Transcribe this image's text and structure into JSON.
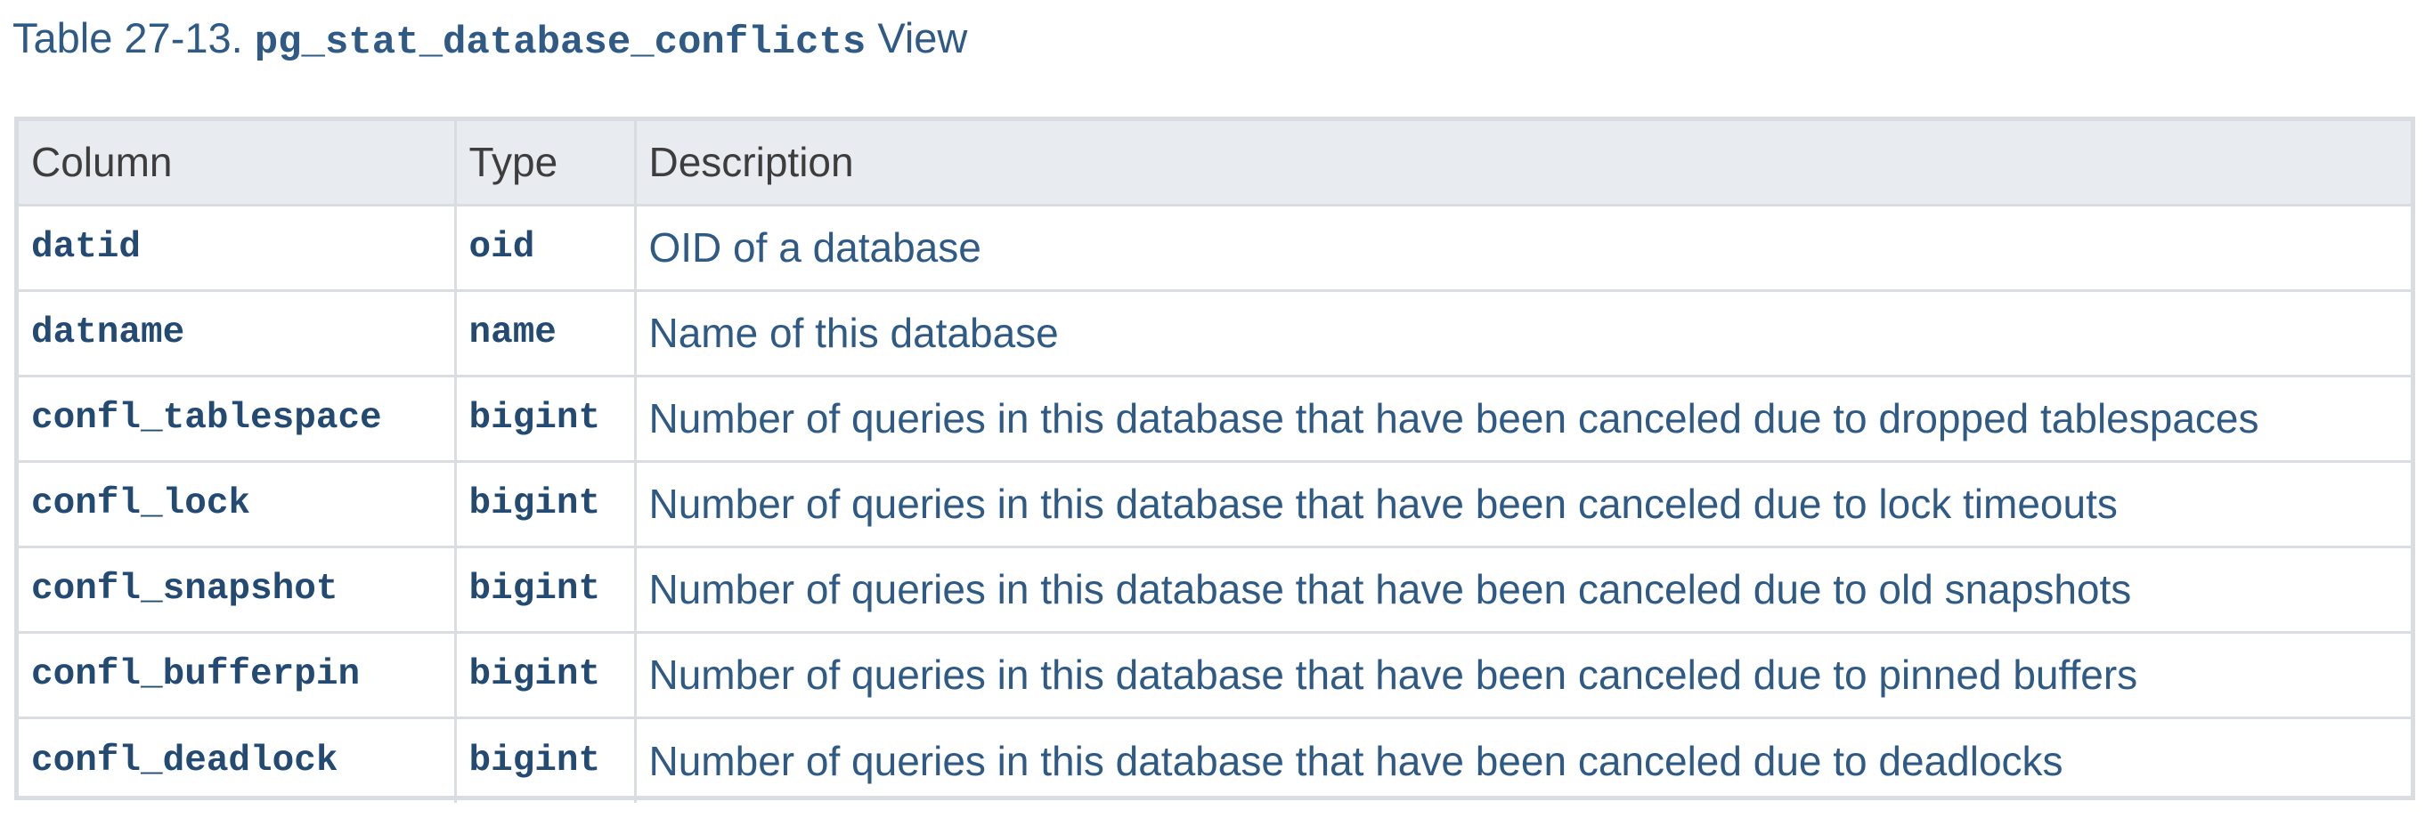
{
  "caption": {
    "prefix": "Table 27-13. ",
    "code": "pg_stat_database_conflicts",
    "suffix": " View"
  },
  "table": {
    "headers": [
      "Column",
      "Type",
      "Description"
    ],
    "rows": [
      {
        "column": "datid",
        "type": "oid",
        "description": "OID of a database"
      },
      {
        "column": "datname",
        "type": "name",
        "description": "Name of this database"
      },
      {
        "column": "confl_tablespace",
        "type": "bigint",
        "description": "Number of queries in this database that have been canceled due to dropped tablespaces"
      },
      {
        "column": "confl_lock",
        "type": "bigint",
        "description": "Number of queries in this database that have been canceled due to lock timeouts"
      },
      {
        "column": "confl_snapshot",
        "type": "bigint",
        "description": "Number of queries in this database that have been canceled due to old snapshots"
      },
      {
        "column": "confl_bufferpin",
        "type": "bigint",
        "description": "Number of queries in this database that have been canceled due to pinned buffers"
      },
      {
        "column": "confl_deadlock",
        "type": "bigint",
        "description": "Number of queries in this database that have been canceled due to deadlocks"
      }
    ]
  }
}
